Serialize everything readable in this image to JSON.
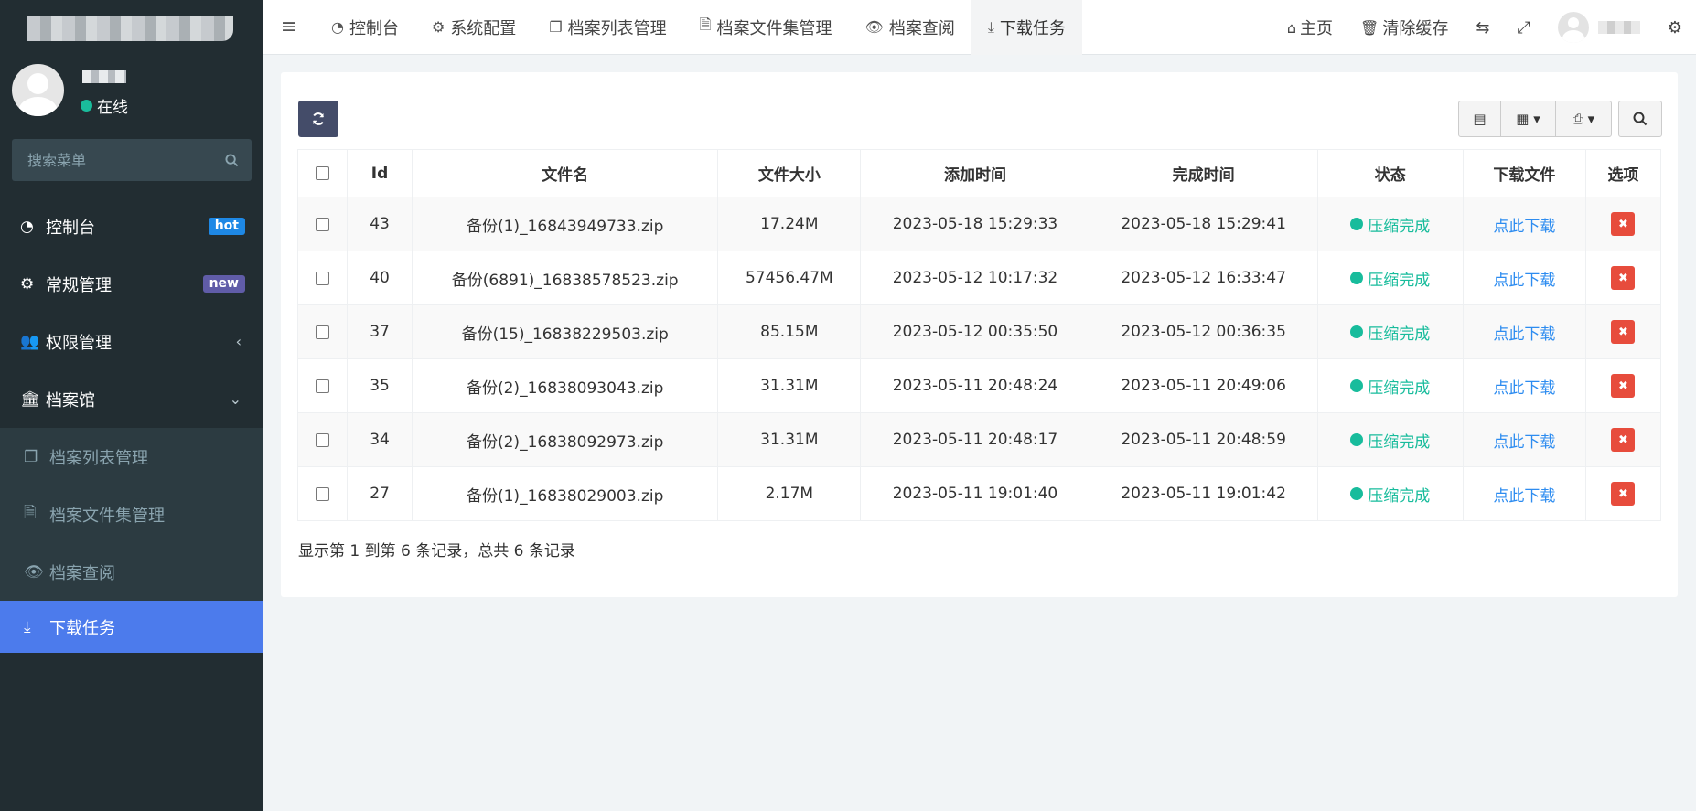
{
  "sidebar": {
    "status": "在线",
    "search_placeholder": "搜索菜单",
    "items": [
      {
        "label": "控制台",
        "badge": "hot"
      },
      {
        "label": "常规管理",
        "badge": "new"
      },
      {
        "label": "权限管理"
      },
      {
        "label": "档案馆"
      }
    ],
    "subitems": [
      {
        "label": "档案列表管理"
      },
      {
        "label": "档案文件集管理"
      },
      {
        "label": "档案查阅"
      },
      {
        "label": "下载任务"
      }
    ]
  },
  "topnav": {
    "tabs": [
      {
        "label": "控制台"
      },
      {
        "label": "系统配置"
      },
      {
        "label": "档案列表管理"
      },
      {
        "label": "档案文件集管理"
      },
      {
        "label": "档案查阅"
      },
      {
        "label": "下载任务"
      }
    ],
    "home": "主页",
    "clear_cache": "清除缓存"
  },
  "table": {
    "headers": [
      "Id",
      "文件名",
      "文件大小",
      "添加时间",
      "完成时间",
      "状态",
      "下载文件",
      "选项"
    ],
    "rows": [
      {
        "id": "43",
        "name": "备份(1)_16843949733.zip",
        "size": "17.24M",
        "added": "2023-05-18 15:29:33",
        "done": "2023-05-18 15:29:41",
        "status": "压缩完成",
        "link": "点此下载"
      },
      {
        "id": "40",
        "name": "备份(6891)_16838578523.zip",
        "size": "57456.47M",
        "added": "2023-05-12 10:17:32",
        "done": "2023-05-12 16:33:47",
        "status": "压缩完成",
        "link": "点此下载"
      },
      {
        "id": "37",
        "name": "备份(15)_16838229503.zip",
        "size": "85.15M",
        "added": "2023-05-12 00:35:50",
        "done": "2023-05-12 00:36:35",
        "status": "压缩完成",
        "link": "点此下载"
      },
      {
        "id": "35",
        "name": "备份(2)_16838093043.zip",
        "size": "31.31M",
        "added": "2023-05-11 20:48:24",
        "done": "2023-05-11 20:49:06",
        "status": "压缩完成",
        "link": "点此下载"
      },
      {
        "id": "34",
        "name": "备份(2)_16838092973.zip",
        "size": "31.31M",
        "added": "2023-05-11 20:48:17",
        "done": "2023-05-11 20:48:59",
        "status": "压缩完成",
        "link": "点此下载"
      },
      {
        "id": "27",
        "name": "备份(1)_16838029003.zip",
        "size": "2.17M",
        "added": "2023-05-11 19:01:40",
        "done": "2023-05-11 19:01:42",
        "status": "压缩完成",
        "link": "点此下载"
      }
    ],
    "summary": "显示第 1 到第 6 条记录，总共 6 条记录"
  },
  "colors": {
    "sidebar_bg": "#222d32",
    "active_item": "#4c7bec",
    "status_green": "#18bc9c",
    "delete_red": "#e74c3c",
    "refresh_btn": "#444c69"
  }
}
